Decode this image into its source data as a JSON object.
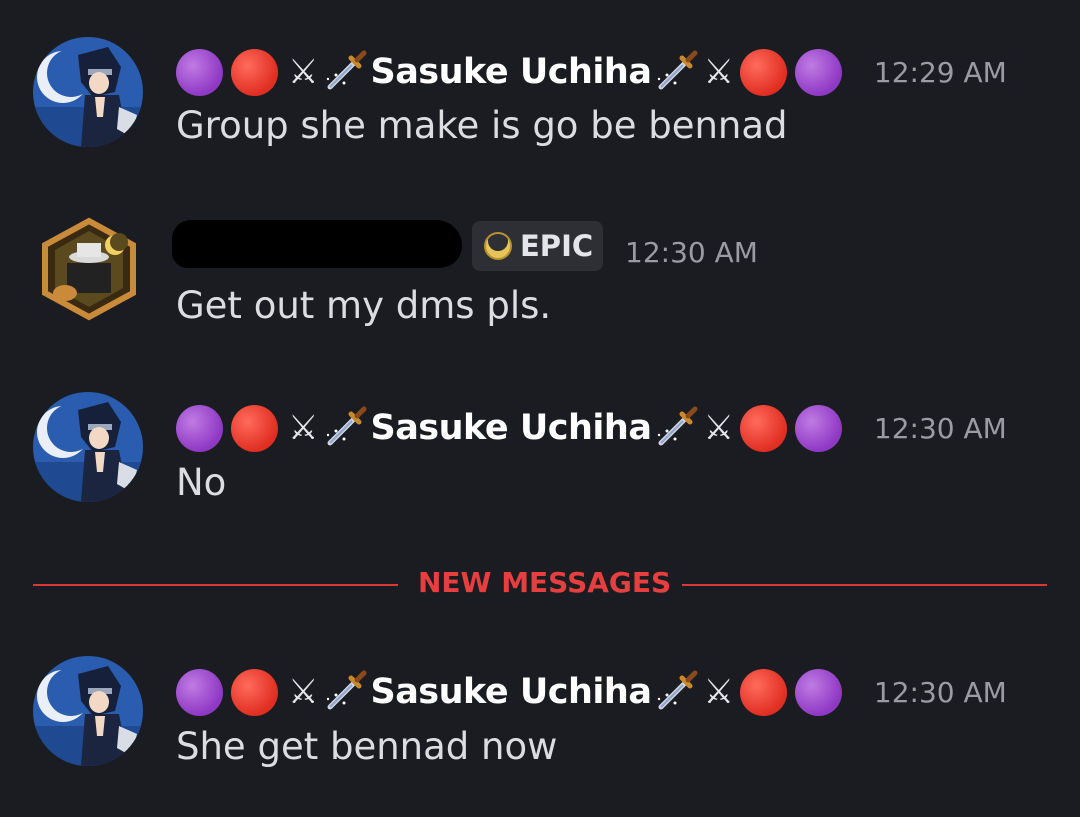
{
  "messages": [
    {
      "author": "Sasuke Uchiha",
      "time": "12:29 AM",
      "text": "Group she make is go be bennad"
    },
    {
      "author": "",
      "badge": "EPIC",
      "time": "12:30 AM",
      "text": "Get out my dms pls."
    },
    {
      "author": "Sasuke Uchiha",
      "time": "12:30 AM",
      "text": "No"
    },
    {
      "author": "Sasuke Uchiha",
      "time": "12:30 AM",
      "text": "She get bennad now"
    }
  ],
  "divider": {
    "label": "NEW MESSAGES",
    "color": "#d93838"
  },
  "decorations": {
    "purple_circle": "purple-circle-emoji",
    "red_circle": "red-circle-emoji",
    "crossed_swords": "crossed-swords-emoji",
    "dagger": "dagger-emoji"
  },
  "colors": {
    "background": "#1b1c21",
    "username": "#ffffff",
    "timestamp": "#9b9ca3",
    "badge_bg": "#2d2f35"
  }
}
